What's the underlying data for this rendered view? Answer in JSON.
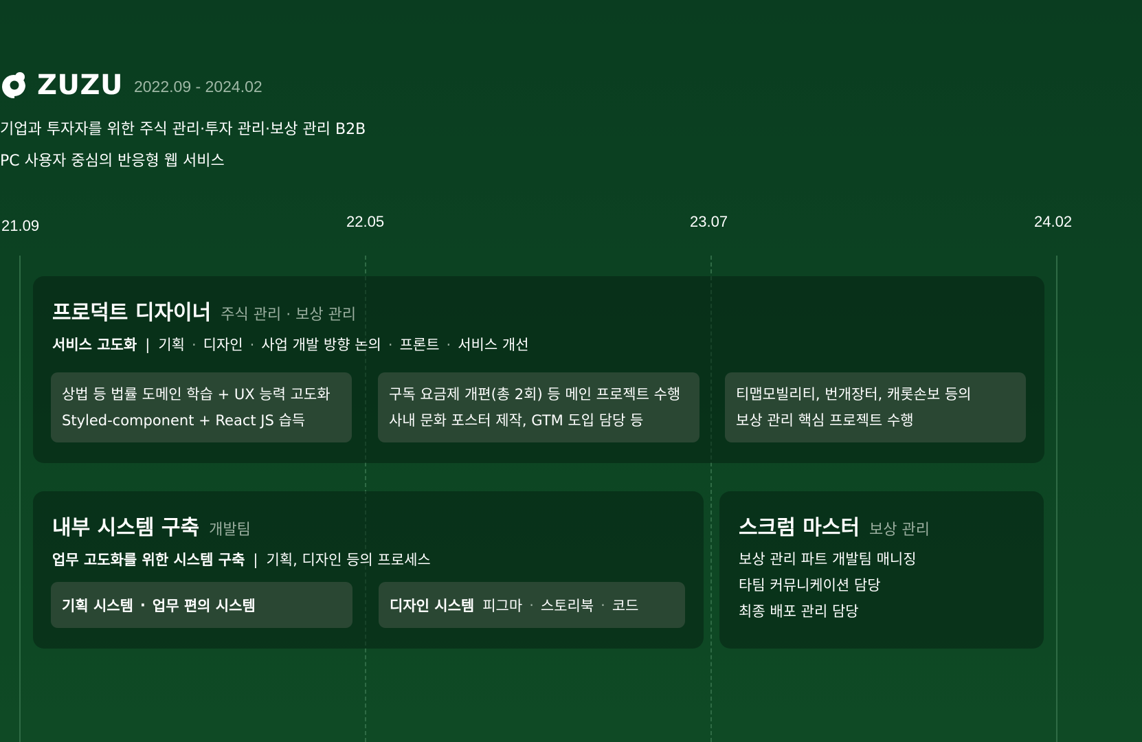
{
  "brand": {
    "name": "ZUZU",
    "logo_icon": "zuzu-logo-icon",
    "period": "2022.09 - 2024.02"
  },
  "description": {
    "line1": "기업과 투자자를 위한 주식 관리·투자 관리·보상 관리 B2B",
    "line2": "PC 사용자 중심의 반응형 웹 서비스"
  },
  "timeline": {
    "labels": [
      "21.09",
      "22.05",
      "23.07",
      "24.02"
    ]
  },
  "product_designer": {
    "title": "프로덕트 디자이너",
    "tag": "주식 관리 · 보상 관리",
    "sub_bold": "서비스 고도화",
    "sub_separator": "|",
    "sub_items": [
      "기획",
      "디자인",
      "사업 개발 방향 논의",
      "프론트",
      "서비스 개선"
    ],
    "cards": [
      {
        "line1": "상법 등 법률 도메인 학습 + UX 능력 고도화",
        "line2": "Styled-component + React JS 습득"
      },
      {
        "line1": "구독 요금제 개편(총 2회) 등 메인 프로젝트 수행",
        "line2": "사내 문화 포스터 제작, GTM 도입 담당 등"
      },
      {
        "line1": "티맵모빌리티, 번개장터, 캐롯손보 등의",
        "line2": "보상 관리 핵심 프로젝트 수행"
      }
    ]
  },
  "internal_system": {
    "title": "내부 시스템 구축",
    "tag": "개발팀",
    "sub_bold": "업무 고도화를 위한 시스템 구축",
    "sub_separator": "|",
    "sub_text": "기획, 디자인 등의 프로세스",
    "card1": {
      "bold_a": "기획 시스템",
      "dot": "·",
      "bold_b": "업무 편의 시스템"
    },
    "card2": {
      "bold": "디자인 시스템",
      "items": [
        "피그마",
        "스토리북",
        "코드"
      ]
    }
  },
  "scrum_master": {
    "title": "스크럼 마스터",
    "tag": "보상 관리",
    "lines": [
      "보상 관리 파트 개발팀 매니징",
      "타팀 커뮤니케이션 담당",
      "최종 배포 관리 담당"
    ]
  },
  "colors": {
    "background": "#0a3d20",
    "panel": "#082a16",
    "card": "#2a4733",
    "muted_text": "#9aae9f",
    "gridline": "#2f6b45"
  }
}
